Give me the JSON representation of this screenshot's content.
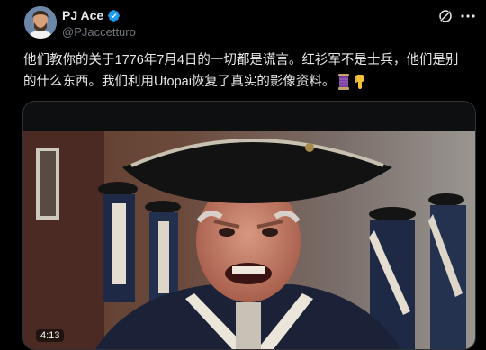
{
  "author": {
    "name": "PJ Ace",
    "handle": "@PJaccetturo",
    "verified": true
  },
  "tweet": {
    "line1": "他们教你的关于1776年7月4日的一切都是谎言。红衫军不是士兵，他们是别",
    "line2": "的什么东西。我们利用Utopai恢复了真实的影像资料。"
  },
  "icons": {
    "verified": "verified-badge-icon",
    "grok": "grok-icon",
    "more": "more-icon",
    "thread": "spool-emoji",
    "down": "pointing-down-emoji"
  },
  "media": {
    "duration": "4:13"
  },
  "colors": {
    "background": "#000000",
    "text": "#e7e9ea",
    "secondary": "#71767b",
    "verified": "#1d9bf0",
    "border": "#2f3336"
  }
}
